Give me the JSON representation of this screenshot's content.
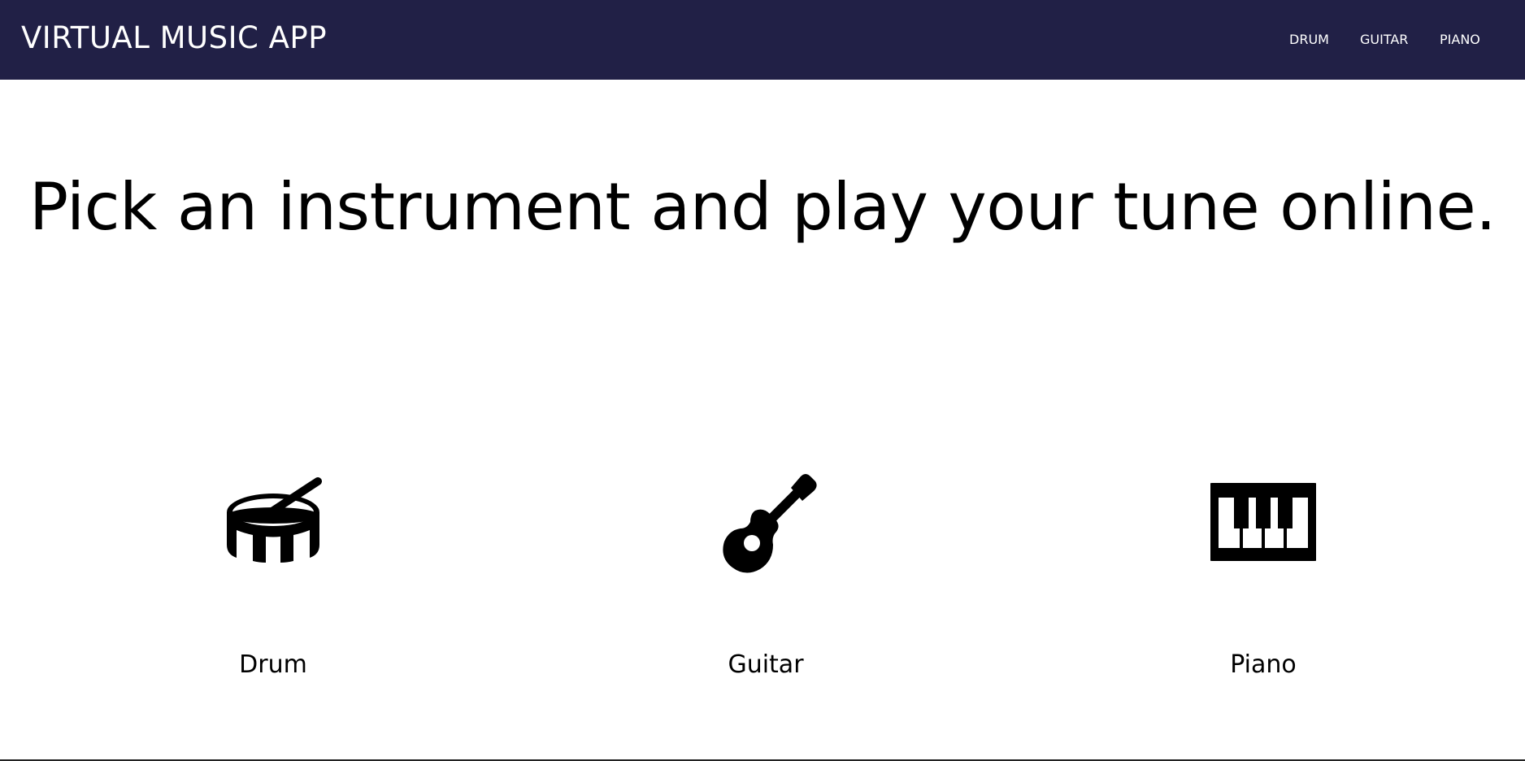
{
  "navbar": {
    "brand": "VIRTUAL MUSIC APP",
    "links": [
      {
        "label": "DRUM"
      },
      {
        "label": "GUITAR"
      },
      {
        "label": "PIANO"
      }
    ],
    "background_color": "#212046",
    "text_color": "#ffffff"
  },
  "main": {
    "headline": "Pick an instrument and play your tune online.",
    "instruments": [
      {
        "label": "Drum",
        "icon": "drum-icon"
      },
      {
        "label": "Guitar",
        "icon": "guitar-icon"
      },
      {
        "label": "Piano",
        "icon": "piano-icon"
      }
    ]
  }
}
